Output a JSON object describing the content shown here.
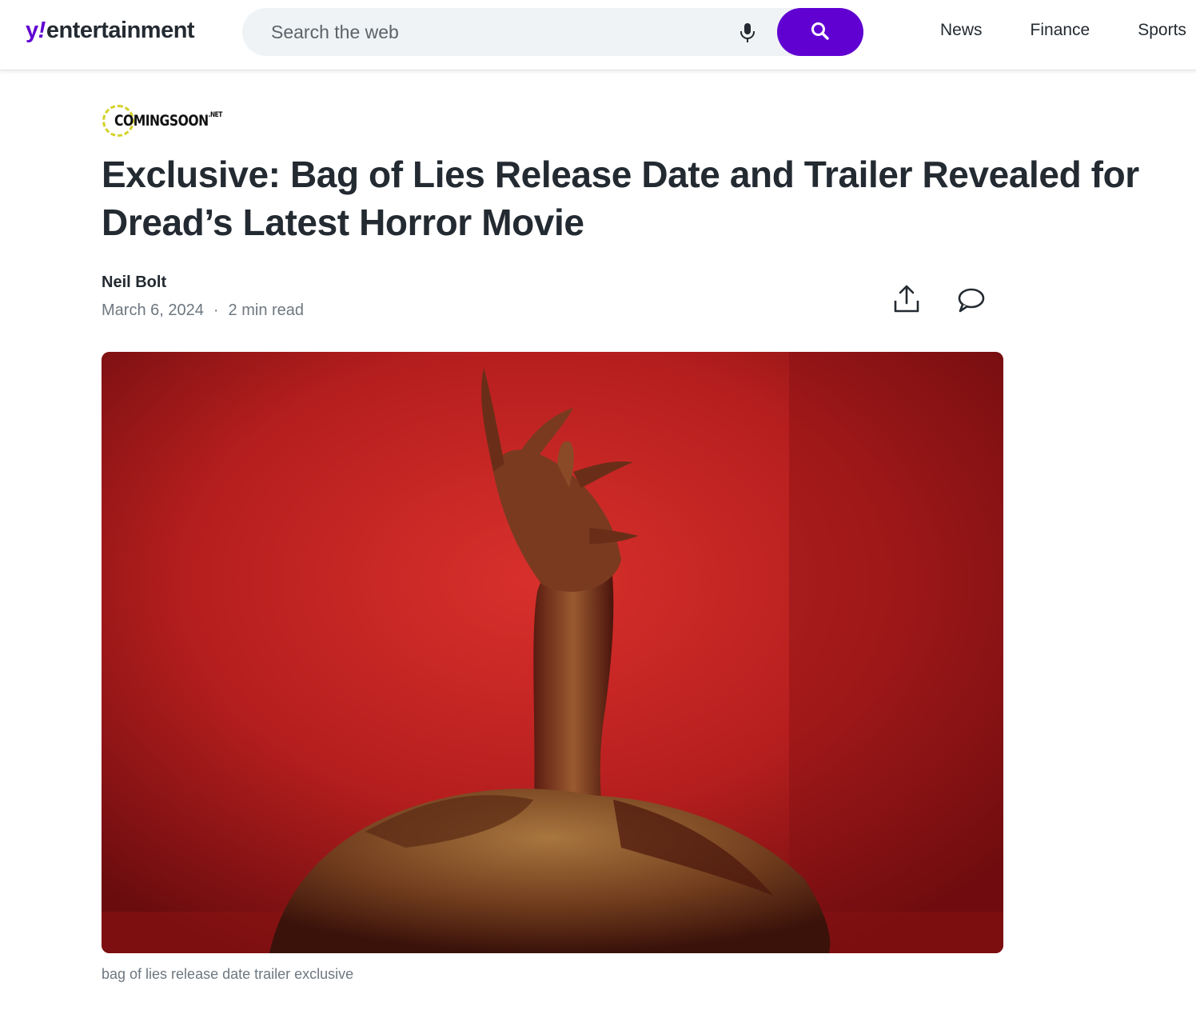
{
  "header": {
    "logo": {
      "y": "y",
      "bang": "!",
      "word": "entertainment"
    },
    "search": {
      "placeholder": "Search the web"
    },
    "nav": [
      {
        "label": "News"
      },
      {
        "label": "Finance"
      },
      {
        "label": "Sports"
      }
    ]
  },
  "article": {
    "source": {
      "name": "COMINGSOON",
      "suffix": ".NET"
    },
    "headline": "Exclusive: Bag of Lies Release Date and Trailer Revealed for Dread’s Latest Horror Movie",
    "author": "Neil Bolt",
    "date": "March 6, 2024",
    "separator": "·",
    "read_time": "2 min read",
    "image_caption": "bag of lies release date trailer exclusive"
  },
  "colors": {
    "brand_purple": "#6001d2",
    "text_primary": "#232a31",
    "text_secondary": "#6e7780",
    "search_bg": "#f0f3f5",
    "hero_red": "#b8201f"
  },
  "icons": {
    "microphone": "mic-icon",
    "search": "search-icon",
    "share": "share-icon",
    "comment": "comment-icon"
  }
}
